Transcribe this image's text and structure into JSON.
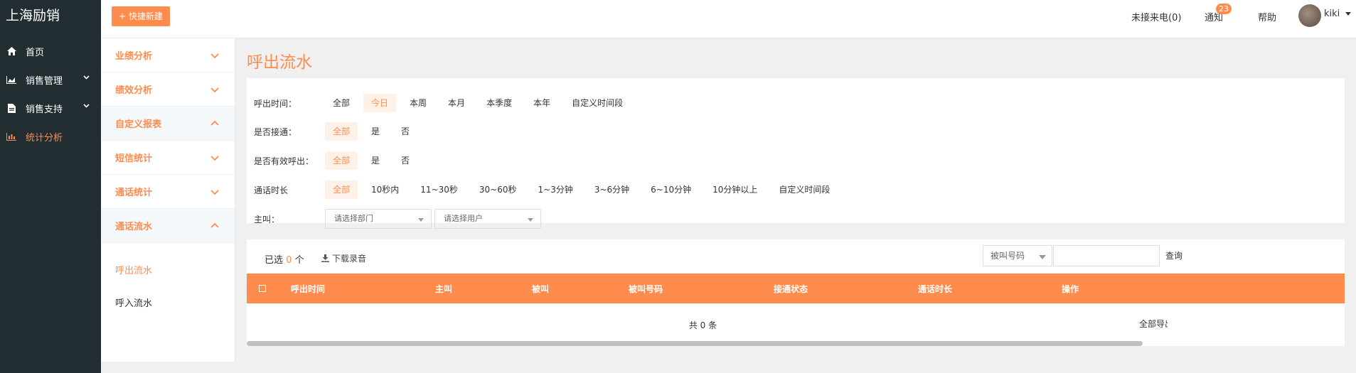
{
  "app": {
    "title": "上海励销"
  },
  "sidebar": {
    "items": [
      {
        "label": "首页",
        "icon": "home-icon"
      },
      {
        "label": "销售管理",
        "icon": "area-chart-icon",
        "has_children": true
      },
      {
        "label": "销售支持",
        "icon": "document-icon",
        "has_children": true
      },
      {
        "label": "统计分析",
        "icon": "bar-chart-icon",
        "active": true
      }
    ]
  },
  "header": {
    "quick_new": "+ 快捷新建",
    "missed_calls": "未接来电(0)",
    "notifications": "通知",
    "notification_count": "23",
    "help": "帮助",
    "user": "kiki"
  },
  "submenu": {
    "groups": [
      {
        "label": "业绩分析",
        "expanded": false
      },
      {
        "label": "绩效分析",
        "expanded": false
      },
      {
        "label": "自定义报表",
        "expanded": true
      },
      {
        "label": "短信统计",
        "expanded": false
      },
      {
        "label": "通话统计",
        "expanded": false
      },
      {
        "label": "通话流水",
        "expanded": true
      }
    ],
    "leaves": [
      {
        "label": "呼出流水",
        "active": true
      },
      {
        "label": "呼入流水",
        "active": false
      }
    ]
  },
  "page": {
    "title": "呼出流水"
  },
  "filters": {
    "call_time": {
      "label": "呼出时间：",
      "options": [
        "全部",
        "今日",
        "本周",
        "本月",
        "本季度",
        "本年",
        "自定义时间段"
      ],
      "selected": "今日"
    },
    "connected": {
      "label": "是否接通：",
      "options": [
        "全部",
        "是",
        "否"
      ],
      "selected": "全部"
    },
    "valid_call": {
      "label": "是否有效呼出：",
      "options": [
        "全部",
        "是",
        "否"
      ],
      "selected": "全部"
    },
    "duration": {
      "label": "通话时长",
      "options": [
        "全部",
        "10秒内",
        "11~30秒",
        "30~60秒",
        "1~3分钟",
        "3~6分钟",
        "6~10分钟",
        "10分钟以上",
        "自定义时间段"
      ],
      "selected": "全部"
    },
    "caller": {
      "label": "主叫：",
      "dept_placeholder": "请选择部门",
      "user_placeholder": "请选择用户"
    }
  },
  "table": {
    "selected_prefix": "已选",
    "selected_count": "0",
    "selected_suffix": "个",
    "download_label": "下载录音",
    "search_type": "被叫号码",
    "search_value": "",
    "query_label": "查询",
    "columns": [
      "呼出时间",
      "主叫",
      "被叫",
      "被叫号码",
      "接通状态",
      "通话时长",
      "操作"
    ],
    "rows": [],
    "total_text": "共 0 条",
    "export_all": "全部导出"
  },
  "colors": {
    "accent": "#ff8c4c",
    "sidebar_bg": "#222d32"
  }
}
